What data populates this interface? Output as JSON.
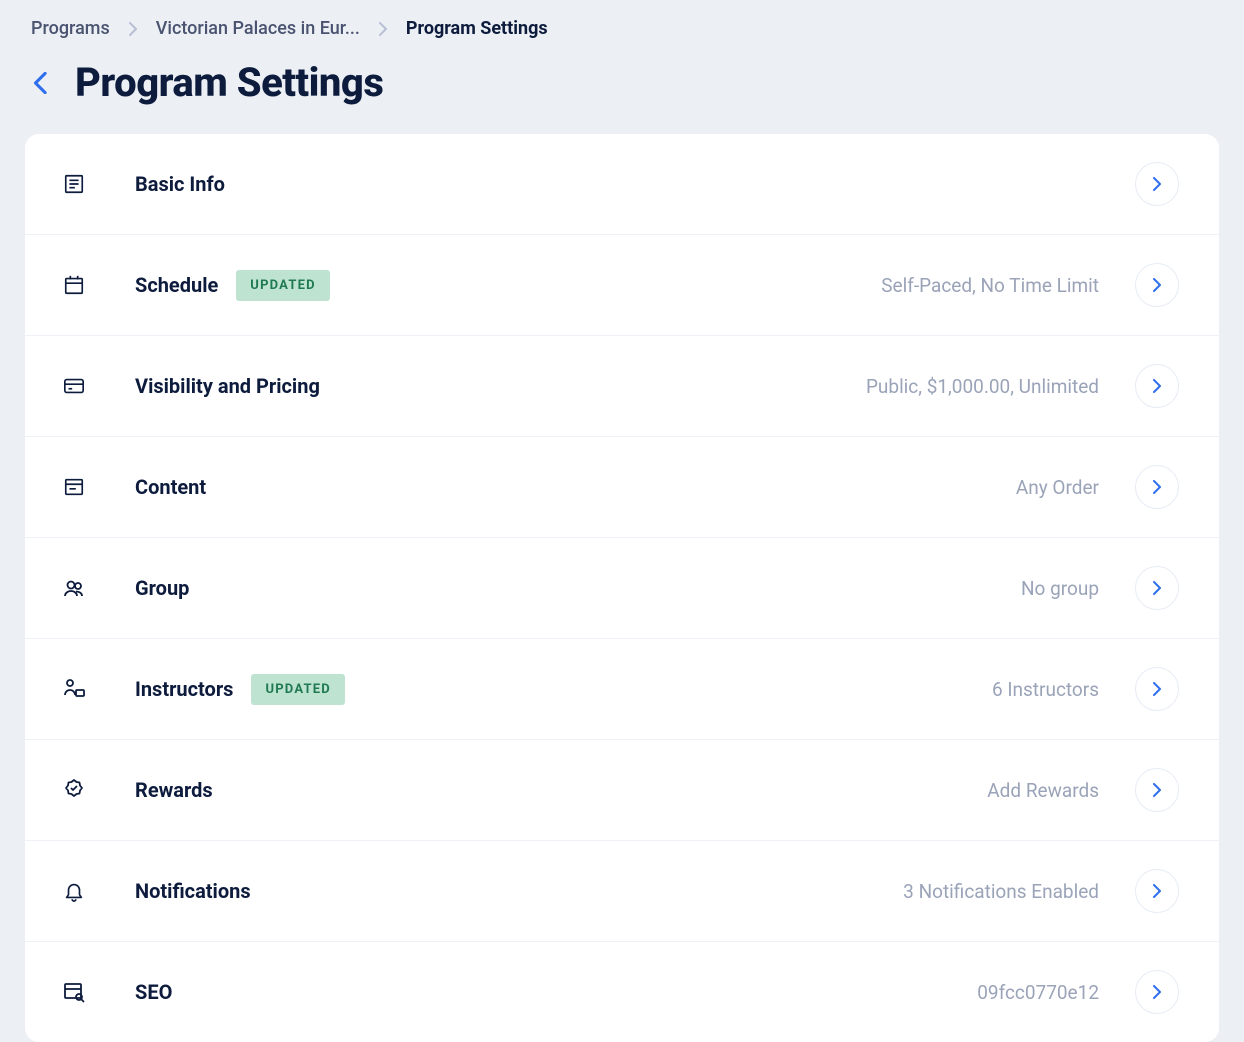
{
  "breadcrumb": {
    "items": [
      {
        "label": "Programs"
      },
      {
        "label": "Victorian Palaces in Eur..."
      },
      {
        "label": "Program Settings"
      }
    ]
  },
  "header": {
    "title": "Program Settings"
  },
  "badge": {
    "updated": "UPDATED"
  },
  "rows": {
    "basic_info": {
      "title": "Basic Info",
      "desc": ""
    },
    "schedule": {
      "title": "Schedule",
      "desc": "Self-Paced, No Time Limit",
      "updated": true
    },
    "visibility": {
      "title": "Visibility and Pricing",
      "desc": "Public, $1,000.00, Unlimited"
    },
    "content": {
      "title": "Content",
      "desc": "Any Order"
    },
    "group": {
      "title": "Group",
      "desc": "No group"
    },
    "instructors": {
      "title": "Instructors",
      "desc": "6 Instructors",
      "updated": true
    },
    "rewards": {
      "title": "Rewards",
      "desc": "Add Rewards"
    },
    "notifications": {
      "title": "Notifications",
      "desc": "3 Notifications Enabled"
    },
    "seo": {
      "title": "SEO",
      "desc": "09fcc0770e12"
    }
  }
}
